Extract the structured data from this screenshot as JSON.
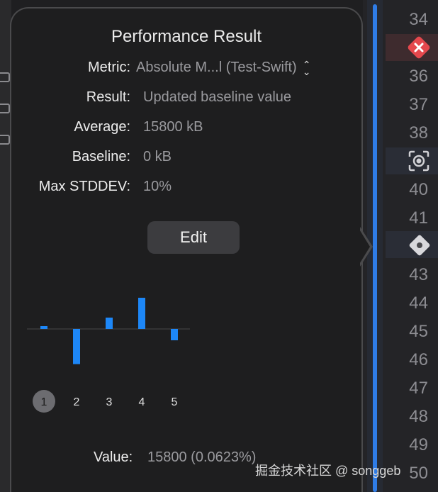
{
  "popover": {
    "title": "Performance Result",
    "fields": [
      {
        "label": "Metric:",
        "value": "Absolute M...l (Test-Swift)"
      },
      {
        "label": "Result:",
        "value": "Updated baseline value"
      },
      {
        "label": "Average:",
        "value": "15800 kB"
      },
      {
        "label": "Baseline:",
        "value": "0 kB"
      },
      {
        "label": "Max STDDEV:",
        "value": "10%"
      }
    ],
    "edit_label": "Edit",
    "footer": {
      "label": "Value:",
      "value": "15800 (0.0623%)"
    }
  },
  "chart_data": {
    "type": "bar",
    "categories": [
      "1",
      "2",
      "3",
      "4",
      "5"
    ],
    "values": [
      0.5,
      -6.2,
      2.0,
      5.5,
      -2.0
    ],
    "selected": "1",
    "colors": {
      "bar": "#1d87f7",
      "selected": "#6c6c70",
      "baseline": "#3a3a3c"
    }
  },
  "gutter": {
    "line_numbers": [
      "34",
      "36",
      "37",
      "38",
      "40",
      "41",
      "43",
      "44",
      "45",
      "46",
      "47",
      "48",
      "49",
      "50"
    ],
    "markers": [
      "error-x-icon",
      "record-icon",
      "diamond-icon"
    ]
  },
  "watermark": "掘金技术社区 @ songgeb",
  "colors": {
    "accent": "#2f7ce6",
    "error": "#e5484d",
    "background": "#1e1e1f"
  }
}
